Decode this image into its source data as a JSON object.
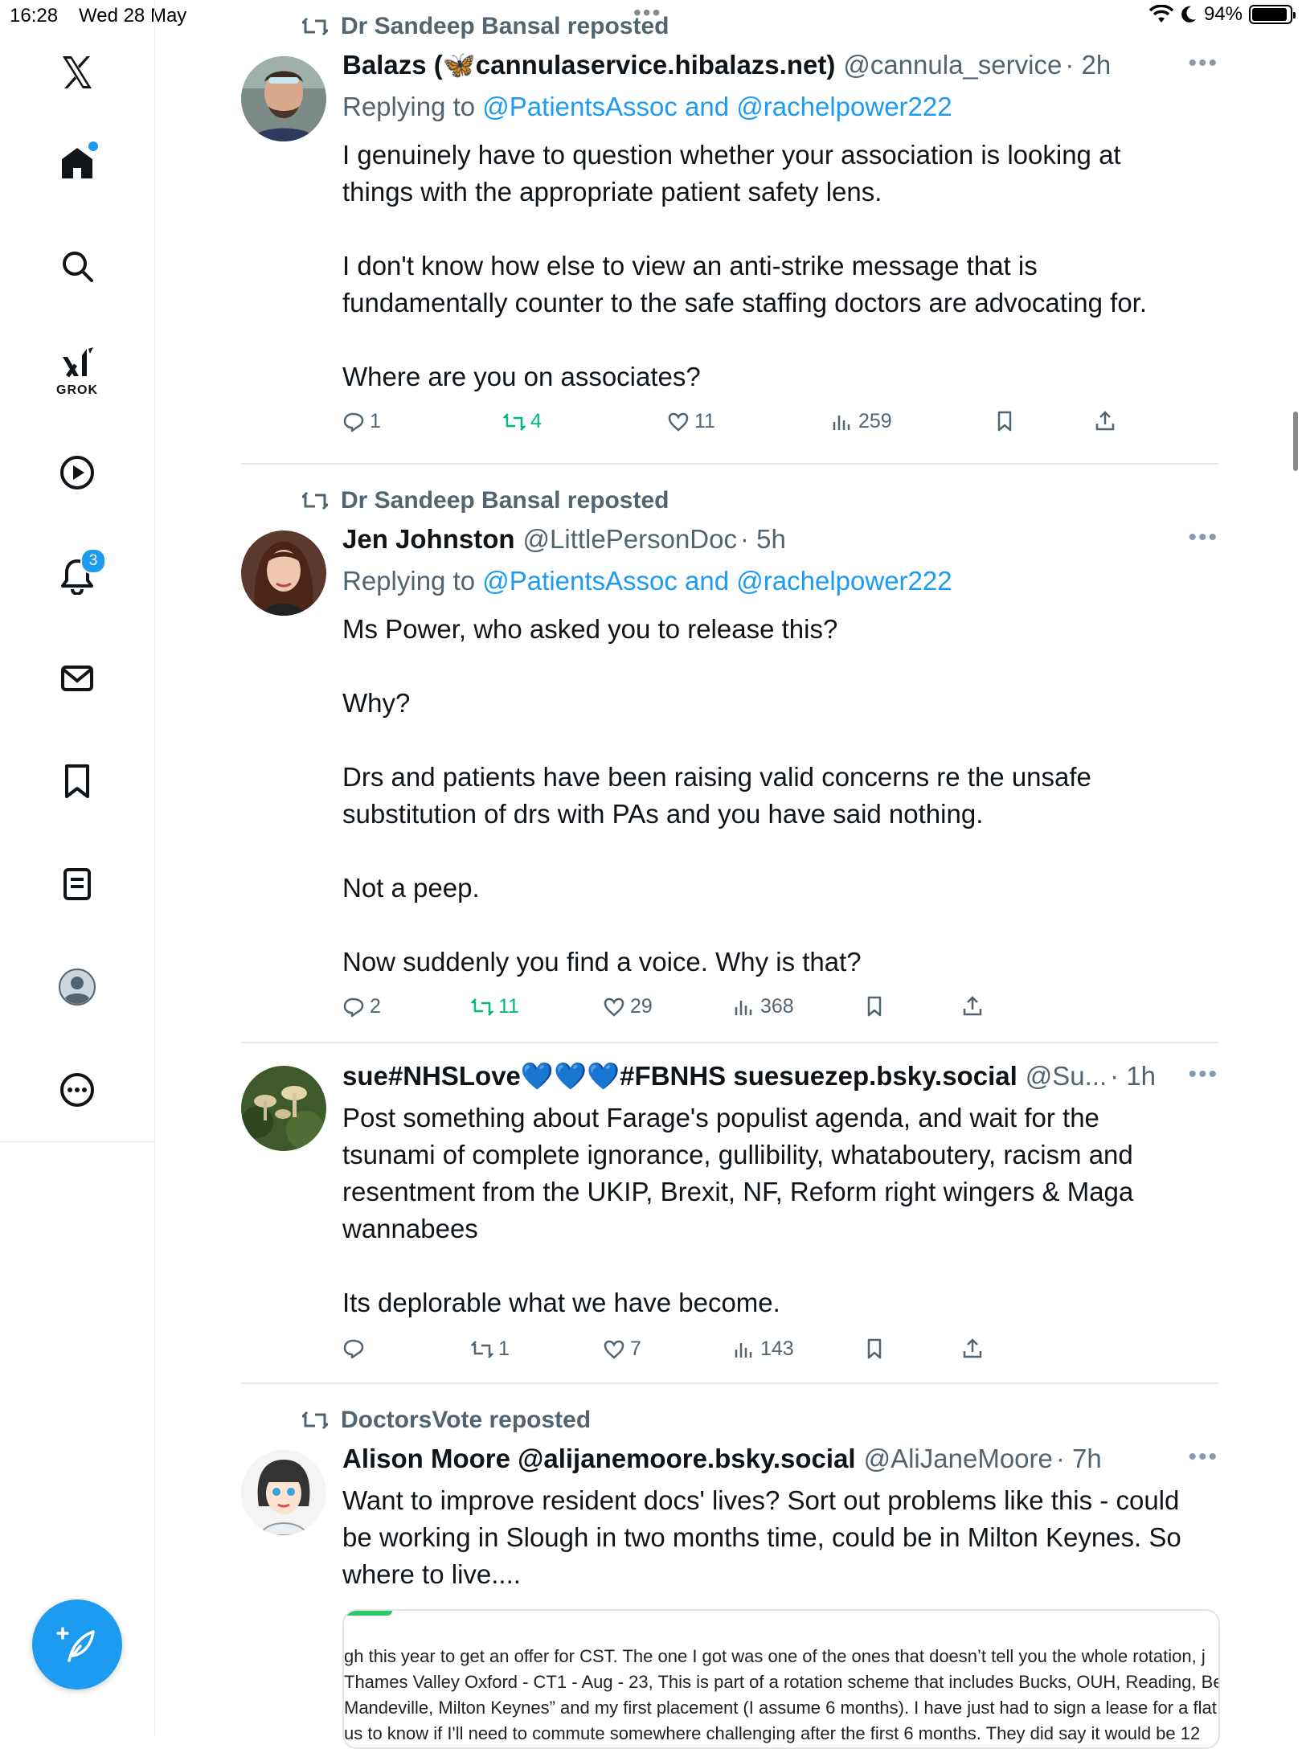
{
  "status_bar": {
    "time": "16:28",
    "date": "Wed 28 May",
    "battery": "94%",
    "battery_level": 0.94
  },
  "sidebar": {
    "items": [
      {
        "name": "home",
        "icon": "home-icon",
        "has_dot": true
      },
      {
        "name": "explore",
        "icon": "search-icon"
      },
      {
        "name": "grok",
        "icon": "grok-icon",
        "label": "GROK"
      },
      {
        "name": "video",
        "icon": "play-icon"
      },
      {
        "name": "notifications",
        "icon": "bell-icon",
        "badge": "3"
      },
      {
        "name": "messages",
        "icon": "mail-icon"
      },
      {
        "name": "bookmarks",
        "icon": "bookmark-icon"
      },
      {
        "name": "articles",
        "icon": "article-icon"
      },
      {
        "name": "profile",
        "icon": "avatar-icon"
      },
      {
        "name": "more",
        "icon": "more-circle-icon"
      }
    ],
    "compose_icon": "compose-feather-icon"
  },
  "posts": [
    {
      "reposted_by": "Dr Sandeep Bansal reposted",
      "name": "Balazs (🦋cannulaservice.hibalazs.net)",
      "handle": "@cannula_service",
      "time": "· 2h",
      "replying_prefix": "Replying to",
      "replying_to": "@PatientsAssoc and @rachelpower222",
      "paragraphs": [
        "I genuinely have to question whether your association is looking at things with the appropriate patient safety lens.",
        "I don't know how else to view an anti-strike message that is fundamentally counter to the safe staffing doctors are advocating for.",
        "Where are you on associates?"
      ],
      "replies": "1",
      "reposts": "4",
      "likes": "11",
      "views": "259"
    },
    {
      "reposted_by": "Dr Sandeep Bansal reposted",
      "name": "Jen Johnston",
      "handle": "@LittlePersonDoc",
      "time": "· 5h",
      "replying_prefix": "Replying to",
      "replying_to": "@PatientsAssoc and @rachelpower222",
      "paragraphs": [
        "Ms Power, who asked you to release this?",
        "Why?",
        "Drs and patients have been raising valid concerns re the unsafe substitution of drs with PAs and you have said nothing.",
        "Not a peep.",
        "Now suddenly you find a voice. Why is that?"
      ],
      "replies": "2",
      "reposts": "11",
      "likes": "29",
      "views": "368"
    },
    {
      "name": "sue#NHSLove💙💙💙#FBNHS suesuezep.bsky.social",
      "handle": "@Su...",
      "time": "· 1h",
      "paragraphs": [
        "Post something about Farage's populist agenda, and wait for the tsunami of complete ignorance, gullibility, whataboutery, racism and resentment from the UKIP, Brexit, NF, Reform right wingers & Maga wannabees",
        "Its deplorable what we have become."
      ],
      "replies": "",
      "reposts": "1",
      "likes": "7",
      "views": "143"
    },
    {
      "reposted_by": "DoctorsVote reposted",
      "name": "Alison Moore @alijanemoore.bsky.social",
      "handle": "@AliJaneMoore",
      "time": "· 7h",
      "paragraphs": [
        "Want to improve resident docs' lives? Sort out problems like this - could be working in Slough in two months time, could be in Milton Keynes. So where to live...."
      ],
      "card_lines": [
        "gh this year to get an offer for CST. The one I got was one of the ones that doesn’t tell you the whole rotation, j",
        " Thames Valley Oxford - CT1 - Aug - 23, This is part of a rotation scheme that includes Bucks, OUH, Reading, Be",
        "Mandeville, Milton Keynes” and my first placement (I assume 6 months). I have just had to sign a lease for a flat",
        "us to know if I'll need to commute somewhere challenging after the first 6 months. They did say it would be 12"
      ]
    }
  ],
  "colors": {
    "accent": "#1d9bf0",
    "repost_green": "#00ba7c",
    "secondary_text": "#536471"
  }
}
